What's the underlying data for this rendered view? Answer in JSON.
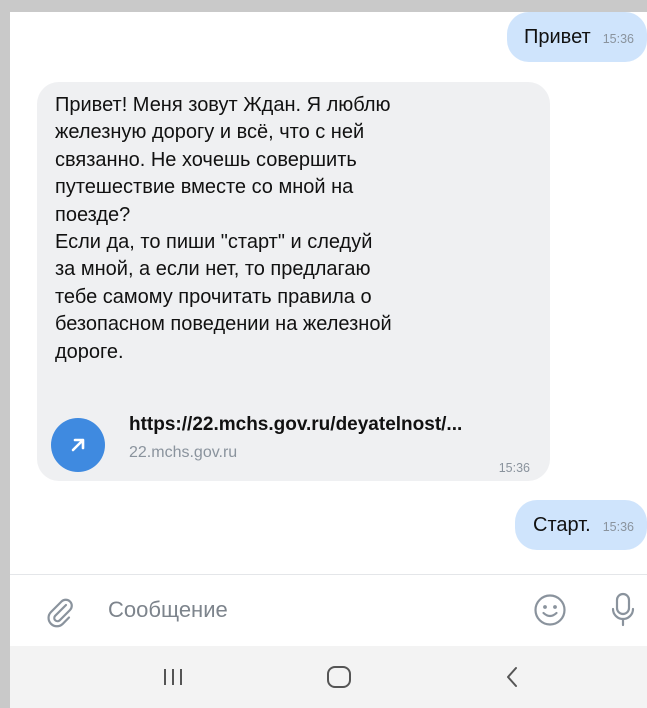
{
  "messages": [
    {
      "direction": "outgoing",
      "text": "Привет",
      "time": "15:36"
    },
    {
      "direction": "incoming",
      "text": "Привет! Меня зовут Ждан. Я люблю\nжелезную дорогу и всё, что с ней\nсвязанно. Не хочешь совершить\nпутешествие вместе со мной на\nпоезде?\n Если да, то пиши \"старт\" и следуй\nза мной, а если нет, то предлагаю\nтебе самому прочитать правила о\nбезопасном поведении на железной\nдороге.",
      "link": {
        "url": "https://22.mchs.gov.ru/deyatelnost/...",
        "domain": "22.mchs.gov.ru",
        "icon": "arrow-up-right-icon"
      },
      "time": "15:36"
    },
    {
      "direction": "outgoing",
      "text": "Старт.",
      "time": "15:36"
    }
  ],
  "composer": {
    "placeholder": "Сообщение",
    "icons": [
      "paperclip-icon",
      "emoji-icon",
      "microphone-icon"
    ]
  },
  "navbar": {
    "icons": [
      "recent-apps-icon",
      "home-icon",
      "back-icon"
    ]
  },
  "colors": {
    "outgoing_bubble": "#cfe4fc",
    "incoming_bubble": "#eff0f2",
    "accent": "#3f8ae0",
    "muted_text": "#8a939d"
  }
}
